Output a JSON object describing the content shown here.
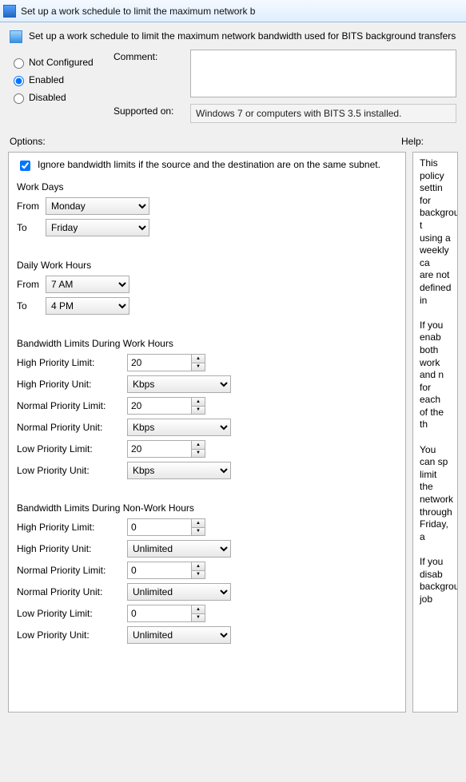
{
  "window": {
    "title": "Set up a work schedule to limit the maximum network b"
  },
  "header": {
    "text": "Set up a work schedule to limit the maximum network bandwidth used for BITS background transfers"
  },
  "radios": {
    "not_configured": "Not Configured",
    "enabled": "Enabled",
    "disabled": "Disabled",
    "selected": "enabled"
  },
  "comment": {
    "label": "Comment:",
    "value": ""
  },
  "supported": {
    "label": "Supported on:",
    "value": "Windows 7 or computers with BITS 3.5 installed."
  },
  "section_labels": {
    "options": "Options:",
    "help": "Help:"
  },
  "options": {
    "ignore_subnet": {
      "label": "Ignore bandwidth limits if the source and the destination are on the same subnet.",
      "checked": true
    },
    "work_days": {
      "title": "Work Days",
      "from_label": "From",
      "to_label": "To",
      "from_value": "Monday",
      "to_value": "Friday"
    },
    "daily_hours": {
      "title": "Daily Work Hours",
      "from_label": "From",
      "to_label": "To",
      "from_value": "7 AM",
      "to_value": "4 PM"
    },
    "work_limits": {
      "title": "Bandwidth Limits During Work Hours",
      "hp_limit_label": "High Priority Limit:",
      "hp_limit_value": "20",
      "hp_unit_label": "High Priority Unit:",
      "hp_unit_value": "Kbps",
      "np_limit_label": "Normal Priority Limit:",
      "np_limit_value": "20",
      "np_unit_label": "Normal Priority Unit:",
      "np_unit_value": "Kbps",
      "lp_limit_label": "Low Priority Limit:",
      "lp_limit_value": "20",
      "lp_unit_label": "Low Priority Unit:",
      "lp_unit_value": "Kbps"
    },
    "nonwork_limits": {
      "title": "Bandwidth Limits During Non-Work Hours",
      "hp_limit_label": "High Priority Limit:",
      "hp_limit_value": "0",
      "hp_unit_label": "High Priority Unit:",
      "hp_unit_value": "Unlimited",
      "np_limit_label": "Normal Priority Limit:",
      "np_limit_value": "0",
      "np_unit_label": "Normal Priority Unit:",
      "np_unit_value": "Unlimited",
      "lp_limit_label": "Low Priority Limit:",
      "lp_limit_value": "0",
      "lp_unit_label": "Low Priority Unit:",
      "lp_unit_value": "Unlimited"
    }
  },
  "help": {
    "p1": "This policy settin",
    "p2": "for background t",
    "p3": "using a weekly ca",
    "p4": "are not defined in",
    "p5": "      If you enab",
    "p6": "both work and n",
    "p7": "for each of the th",
    "p8": "      You can sp",
    "p9": "limit the network",
    "p10": "through Friday, a",
    "p11": "      If you disab",
    "p12": "background job "
  }
}
